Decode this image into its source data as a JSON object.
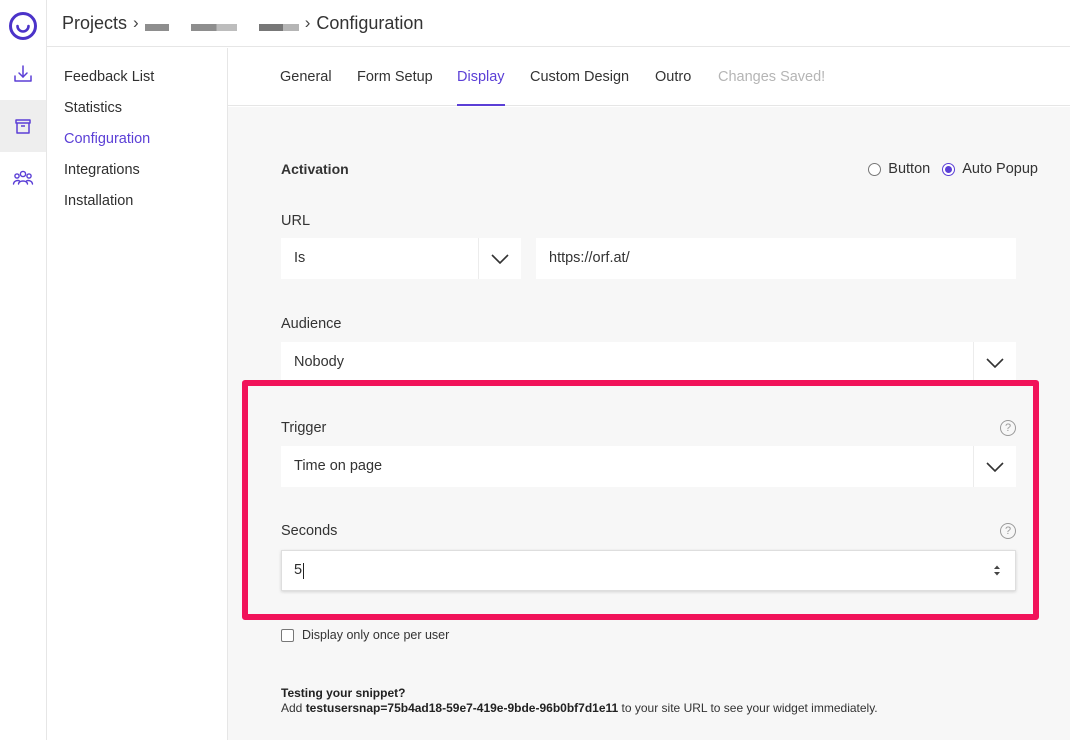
{
  "colors": {
    "accent": "#5b3fd6",
    "highlight": "#f1135a",
    "muted": "#b5b5b5"
  },
  "rail": {
    "icons": [
      "usersnap-logo-icon",
      "download-icon",
      "archive-box-icon",
      "team-icon"
    ],
    "active_index": 2
  },
  "header": {
    "breadcrumb_root": "Projects",
    "breadcrumb_current": "Configuration"
  },
  "subnav": {
    "items": [
      {
        "label": "Feedback List"
      },
      {
        "label": "Statistics"
      },
      {
        "label": "Configuration"
      },
      {
        "label": "Integrations"
      },
      {
        "label": "Installation"
      }
    ],
    "active_index": 2
  },
  "tabs": {
    "items": [
      {
        "label": "General"
      },
      {
        "label": "Form Setup"
      },
      {
        "label": "Display"
      },
      {
        "label": "Custom Design"
      },
      {
        "label": "Outro"
      }
    ],
    "active_index": 2,
    "status": "Changes Saved!"
  },
  "activation": {
    "label": "Activation",
    "options": [
      "Button",
      "Auto Popup"
    ],
    "selected": "Auto Popup"
  },
  "url": {
    "label": "URL",
    "operator": "Is",
    "value": "https://orf.at/"
  },
  "audience": {
    "label": "Audience",
    "value": "Nobody"
  },
  "trigger": {
    "label": "Trigger",
    "value": "Time on page",
    "help": "?"
  },
  "seconds": {
    "label": "Seconds",
    "value": "5",
    "help": "?"
  },
  "display_once": {
    "label": "Display only once per user",
    "checked": false
  },
  "snippet": {
    "title": "Testing your snippet?",
    "prefix": "Add ",
    "code": "testusersnap=75b4ad18-59e7-419e-9bde-96b0bf7d1e11",
    "suffix": " to your site URL to see your widget immediately."
  }
}
